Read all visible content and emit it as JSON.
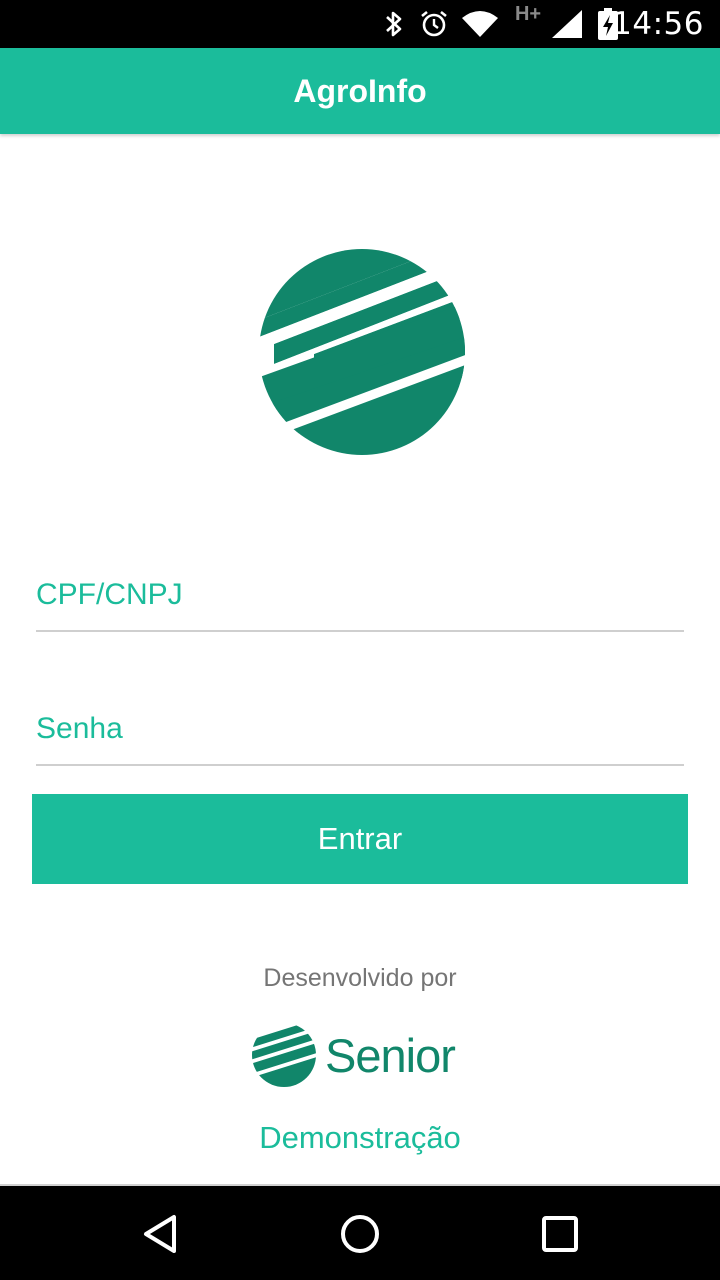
{
  "status_bar": {
    "time": "14:56",
    "network_label": "H+",
    "icons": [
      "bluetooth-icon",
      "alarm-icon",
      "wifi-icon",
      "signal-icon",
      "battery-charging-icon"
    ]
  },
  "app_bar": {
    "title": "AgroInfo"
  },
  "login": {
    "cpf_placeholder": "CPF/CNPJ",
    "senha_placeholder": "Senha",
    "submit_label": "Entrar"
  },
  "footer": {
    "developed_by": "Desenvolvido por",
    "brand_name": "Senior",
    "demo_link": "Demonstração"
  },
  "nav_bar": {
    "icons": [
      "back-icon",
      "home-icon",
      "recents-icon"
    ]
  },
  "colors": {
    "accent": "#1bbc9b",
    "logo_green": "#11866a",
    "status_bar": "#000000",
    "text_gray": "#757575"
  }
}
